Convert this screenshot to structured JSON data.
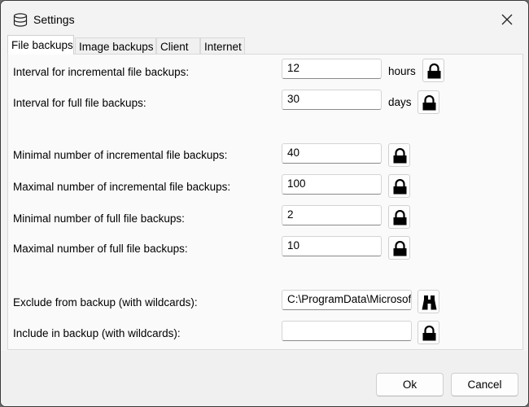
{
  "window": {
    "title": "Settings"
  },
  "tabs": [
    {
      "label": "File backups",
      "active": true
    },
    {
      "label": "Image backups"
    },
    {
      "label": "Client"
    },
    {
      "label": "Internet"
    }
  ],
  "settings": {
    "incr_interval": {
      "label": "Interval for incremental file backups:",
      "value": "12",
      "unit": "hours",
      "icon": "lock-icon"
    },
    "full_interval": {
      "label": "Interval for full file backups:",
      "value": "30",
      "unit": "days",
      "icon": "lock-icon"
    },
    "min_incr": {
      "label": "Minimal number of incremental file backups:",
      "value": "40",
      "icon": "lock-icon"
    },
    "max_incr": {
      "label": "Maximal number of incremental file backups:",
      "value": "100",
      "icon": "lock-icon"
    },
    "min_full": {
      "label": "Minimal number of full file backups:",
      "value": "2",
      "icon": "lock-icon"
    },
    "max_full": {
      "label": "Maximal number of full file backups:",
      "value": "10",
      "icon": "lock-icon"
    },
    "exclude": {
      "label": "Exclude from backup (with wildcards):",
      "value": "C:\\ProgramData\\Microsoft",
      "icon": "binoculars-icon"
    },
    "include": {
      "label": "Include in backup (with wildcards):",
      "value": "",
      "icon": "lock-icon"
    }
  },
  "buttons": {
    "ok": "Ok",
    "cancel": "Cancel"
  },
  "icons": {
    "app": "database-icon",
    "close": "close-icon"
  }
}
